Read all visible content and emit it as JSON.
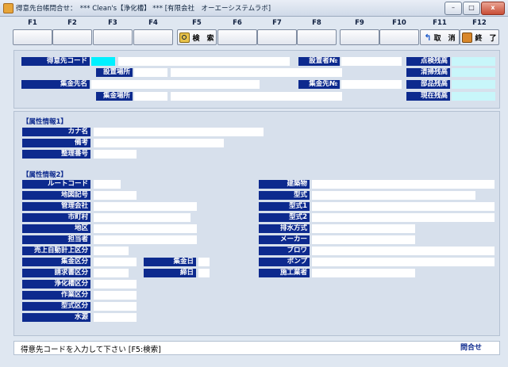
{
  "window": {
    "title": "得意先台帳問合せ：　*** Clean's【浄化槽】 *** [有限会社　オーエーシステムラボ]",
    "minimize": "–",
    "maximize": "□",
    "close": "x"
  },
  "fkeys": [
    {
      "key": "F1",
      "label": ""
    },
    {
      "key": "F2",
      "label": ""
    },
    {
      "key": "F3",
      "label": ""
    },
    {
      "key": "F4",
      "label": ""
    },
    {
      "key": "F5",
      "label": "検　索",
      "icon": "search-icon"
    },
    {
      "key": "F6",
      "label": ""
    },
    {
      "key": "F7",
      "label": ""
    },
    {
      "key": "F8",
      "label": ""
    },
    {
      "key": "F9",
      "label": ""
    },
    {
      "key": "F10",
      "label": ""
    },
    {
      "key": "F11",
      "label": "取　消",
      "icon": "cancel-icon"
    },
    {
      "key": "F12",
      "label": "終　了",
      "icon": "exit-icon"
    }
  ],
  "header": {
    "customer_code": "得意先コード",
    "install_location": "設置場所",
    "collector_name": "集金先名",
    "collection_location": "集金場所",
    "installer_no": "設置者№",
    "collector_no": "集金先№",
    "inspection_balance": "点検残高",
    "cleaning_balance": "清掃残高",
    "parts_balance": "部品残高",
    "current_balance": "現在残高"
  },
  "attr1": {
    "title": "【属性情報1】",
    "kana": "カナ名",
    "remarks": "備考",
    "ref_no": "整理番号"
  },
  "attr2": {
    "title": "【属性情報2】",
    "left": [
      "ルートコード",
      "地図記号",
      "管理会社",
      "市町村",
      "地区",
      "担当者",
      "売上自動計上区分",
      "集金区分",
      "請求書区分",
      "浄化槽区分",
      "作業区分",
      "型式区分",
      "水源"
    ],
    "collection_day": "集金日",
    "cutoff_day": "締日",
    "right": [
      "建築物",
      "型式",
      "型式1",
      "型式2",
      "排水方式",
      "メーカー",
      "ブロワ",
      "ポンプ",
      "施工業者"
    ]
  },
  "status": {
    "message": "得意先コードを入力して下さい [F5:検索]",
    "mode": "問合せ"
  }
}
